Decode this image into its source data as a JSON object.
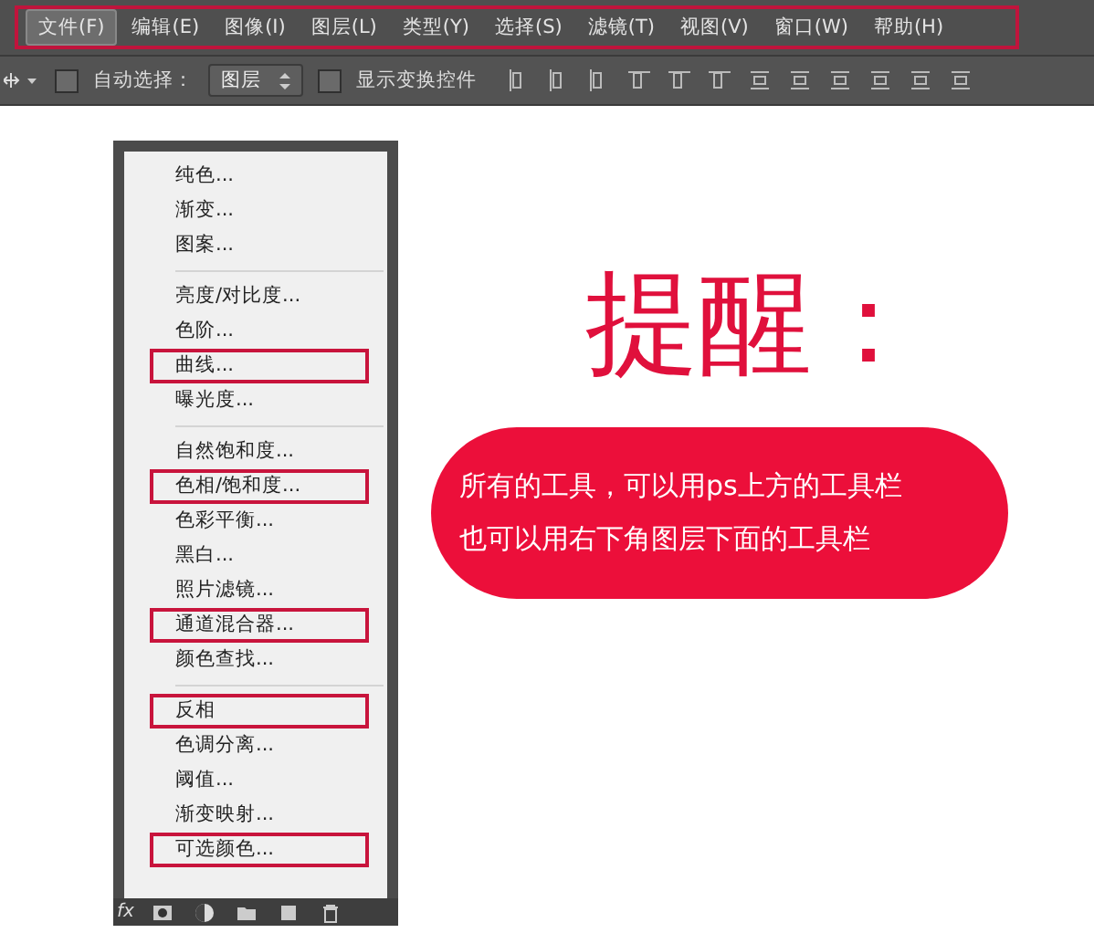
{
  "menubar": {
    "items": [
      {
        "label": "文件(F)",
        "selected": true
      },
      {
        "label": "编辑(E)",
        "selected": false
      },
      {
        "label": "图像(I)",
        "selected": false
      },
      {
        "label": "图层(L)",
        "selected": false
      },
      {
        "label": "类型(Y)",
        "selected": false
      },
      {
        "label": "选择(S)",
        "selected": false
      },
      {
        "label": "滤镜(T)",
        "selected": false
      },
      {
        "label": "视图(V)",
        "selected": false
      },
      {
        "label": "窗口(W)",
        "selected": false
      },
      {
        "label": "帮助(H)",
        "selected": false
      }
    ]
  },
  "options_bar": {
    "auto_select": {
      "label": "自动选择：",
      "checked": false
    },
    "layer_select": {
      "value": "图层"
    },
    "show_transform": {
      "label": "显示变换控件",
      "checked": false
    }
  },
  "adjustment_menu": {
    "groups": [
      [
        {
          "label": "纯色...",
          "highlighted": false
        },
        {
          "label": "渐变...",
          "highlighted": false
        },
        {
          "label": "图案...",
          "highlighted": false
        }
      ],
      [
        {
          "label": "亮度/对比度...",
          "highlighted": false
        },
        {
          "label": "色阶...",
          "highlighted": false
        },
        {
          "label": "曲线...",
          "highlighted": true
        },
        {
          "label": "曝光度...",
          "highlighted": false
        }
      ],
      [
        {
          "label": "自然饱和度...",
          "highlighted": false
        },
        {
          "label": "色相/饱和度...",
          "highlighted": true
        },
        {
          "label": "色彩平衡...",
          "highlighted": false
        },
        {
          "label": "黑白...",
          "highlighted": false
        },
        {
          "label": "照片滤镜...",
          "highlighted": false
        },
        {
          "label": "通道混合器...",
          "highlighted": true
        },
        {
          "label": "颜色查找...",
          "highlighted": false
        }
      ],
      [
        {
          "label": "反相",
          "highlighted": true
        },
        {
          "label": "色调分离...",
          "highlighted": false
        },
        {
          "label": "阈值...",
          "highlighted": false
        },
        {
          "label": "渐变映射...",
          "highlighted": false
        },
        {
          "label": "可选颜色...",
          "highlighted": true
        }
      ]
    ]
  },
  "layers_footer": {
    "fx_label": "fx"
  },
  "callout": {
    "title": "提醒：",
    "lines": [
      "所有的工具，可以用ps上方的工具栏",
      "也可以用右下角图层下面的工具栏"
    ]
  }
}
